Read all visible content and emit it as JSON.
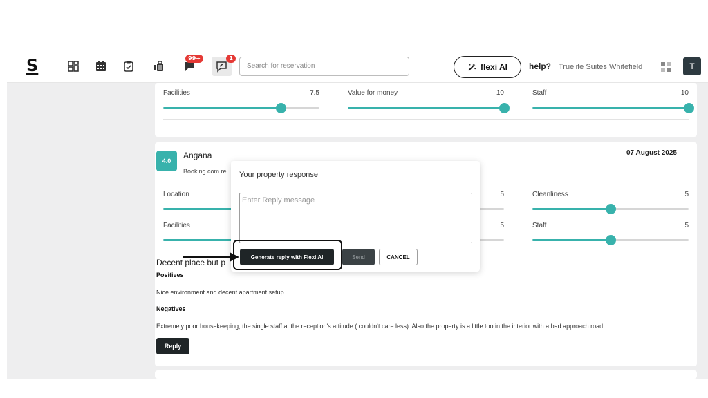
{
  "header": {
    "logo": "S",
    "nav_icons": [
      "dashboard-icon",
      "calendar-icon",
      "clipboard-icon",
      "luggage-icon",
      "chat-icon",
      "reviews-icon"
    ],
    "chat_badge": "99+",
    "reviews_badge": "1",
    "search_placeholder": "Search for reservation",
    "flexi_label": "flexi AI",
    "help_label": "help?",
    "property_name": "Truelife Suites Whitefield",
    "avatar_letter": "T"
  },
  "prev_review": {
    "ratings": [
      {
        "label": "Facilities",
        "value": "7.5",
        "fraction": 0.75
      },
      {
        "label": "Value for money",
        "value": "10",
        "fraction": 1.0
      },
      {
        "label": "Staff",
        "value": "10",
        "fraction": 1.0
      }
    ]
  },
  "review": {
    "score": "4.0",
    "guest": "Angana",
    "source": "Booking.com re",
    "date": "07 August 2025",
    "ratings": [
      {
        "label": "Location",
        "value": "",
        "fraction": 0.5
      },
      {
        "label": "",
        "value": "5",
        "fraction": 0.5
      },
      {
        "label": "Cleanliness",
        "value": "5",
        "fraction": 0.5
      },
      {
        "label": "Facilities",
        "value": "",
        "fraction": 0.5
      },
      {
        "label": "",
        "value": "5",
        "fraction": 0.5
      },
      {
        "label": "Staff",
        "value": "5",
        "fraction": 0.5
      }
    ],
    "title": "Decent place but p",
    "positives_heading": "Positives",
    "positives_text": "Nice environment and decent apartment setup",
    "negatives_heading": "Negatives",
    "negatives_text": "Extremely poor housekeeping, the single staff at the reception's attitude ( couldn't care less). Also the property is a little too in the interior with a bad approach road.",
    "reply_label": "Reply"
  },
  "modal": {
    "title": "Your property response",
    "placeholder": "Enter Reply message",
    "generate_label": "Generate reply with Flexi AI",
    "send_label": "Send",
    "cancel_label": "CANCEL"
  },
  "colors": {
    "accent": "#38b2ac",
    "dark": "#1f2527"
  }
}
